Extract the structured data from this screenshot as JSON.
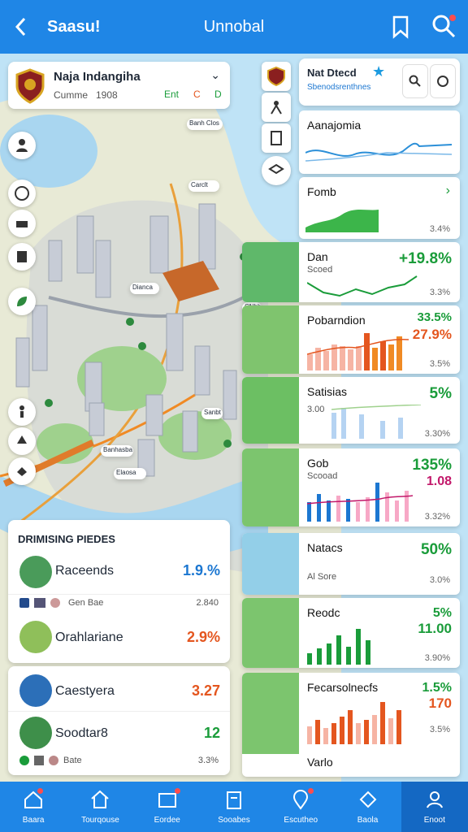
{
  "header": {
    "back_label": "<",
    "left_title": "Saasu!",
    "center_title": "Unnobal"
  },
  "location_card": {
    "name": "Naja Indangiha",
    "meta_a": "Cumme",
    "meta_b": "1908",
    "chip_a": "Ent",
    "chip_b": "C",
    "chip_c": "D"
  },
  "top_panel": {
    "title": "Nat Dtecd",
    "subtitle": "Sbenodsrenthnes"
  },
  "map_labels": [
    "Banh Clos",
    "Carclt",
    "Dianca",
    "Sanbt",
    "CNbb",
    "Banhasba",
    "Elaosa"
  ],
  "tiles": [
    {
      "label": "Aanajomia",
      "sub": "",
      "big": "",
      "small": ""
    },
    {
      "label": "Fomb",
      "sub": "",
      "big": "",
      "small": "3.4%"
    },
    {
      "label": "Dan",
      "sub": "Scoed",
      "big": "+19.8%",
      "small": "3.3%"
    },
    {
      "label": "Pobarndion",
      "sub": "",
      "big": "33.5%",
      "big2": "27.9%",
      "small": "3.5%"
    },
    {
      "label": "Satisias",
      "sub": "3.00",
      "big": "5%",
      "small": "3.30%"
    },
    {
      "label": "Gob",
      "sub": "Scooad",
      "big": "135%",
      "big2": "1.08",
      "small": "3.32%"
    },
    {
      "label": "Natacs",
      "sub": "Al   Sore",
      "big": "50%",
      "small": "3.0%"
    },
    {
      "label": "Reodc",
      "sub": "",
      "big": "5%",
      "big2": "11.00",
      "small": "3.90%"
    },
    {
      "label": "Fecarsolnecfs",
      "sub": "",
      "big": "1.5%",
      "big2": "170",
      "small": "3.5%"
    },
    {
      "label": "Varlo",
      "sub": "",
      "big": "",
      "small": ""
    }
  ],
  "rankings": {
    "title": "DRIMISING PIEDES",
    "rows": [
      {
        "name": "Raceends",
        "value": "1.9.%",
        "meta": "Gen Bae",
        "meta2": "2.840",
        "color": "#1c77d1"
      },
      {
        "name": "Orahlariane",
        "value": "2.9%",
        "meta": "",
        "meta2": "",
        "color": "#e4561f"
      },
      {
        "name": "Caestyera",
        "value": "3.27",
        "meta": "",
        "meta2": "",
        "color": "#e4561f"
      },
      {
        "name": "Soodtar8",
        "value": "12",
        "meta": "Bate",
        "meta2": "3.3%",
        "color": "#1a9c3a"
      }
    ]
  },
  "bottom_nav": [
    {
      "label": "Baara",
      "icon": "home-alt-icon"
    },
    {
      "label": "Tourqouse",
      "icon": "house-icon"
    },
    {
      "label": "Eordee",
      "icon": "ticket-icon"
    },
    {
      "label": "Sooabes",
      "icon": "clipboard-icon"
    },
    {
      "label": "Escutheo",
      "icon": "pin-icon"
    },
    {
      "label": "Baola",
      "icon": "badge-icon"
    },
    {
      "label": "Enoot",
      "icon": "user-icon"
    }
  ],
  "colors": {
    "primary": "#1f86e6",
    "primary_dark": "#1468c3",
    "green": "#1a9c3a",
    "orange": "#e4561f",
    "blue": "#1c77d1"
  }
}
